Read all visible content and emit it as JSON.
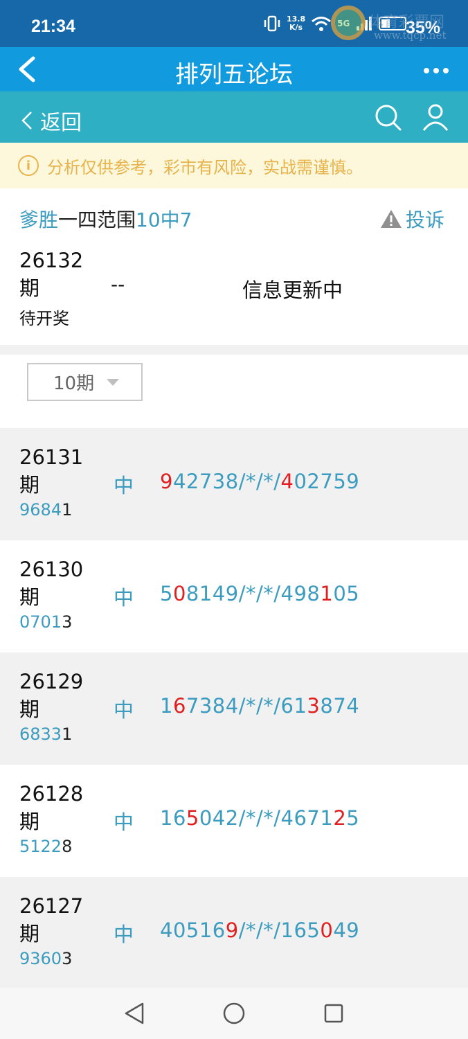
{
  "status_bar": {
    "time": "21:34",
    "net_speed_value": "13.8",
    "net_speed_unit": "K/s",
    "network": "5G",
    "battery": "35%",
    "watermark": "体育彩票网",
    "watermark_url": "www.tqcp.net"
  },
  "app_bar": {
    "title": "排列五论坛"
  },
  "sub_bar": {
    "back_label": "返回"
  },
  "notice": {
    "icon": "i",
    "text": "分析仅供参考，彩市有风险，实战需谨慎。"
  },
  "post": {
    "author": "爹胜",
    "title": "一四范围",
    "hit_rate": "10中7",
    "complain_label": "投诉",
    "current": {
      "issue": "26132",
      "issue_suffix": "期",
      "status": "待开奖",
      "prediction": "--",
      "note": "信息更新中"
    }
  },
  "filter": {
    "selected": "10期"
  },
  "records": [
    {
      "issue": "26131",
      "suffix": "期",
      "draw_hit": "9684",
      "draw_rest": "1",
      "result": "中",
      "pred": [
        {
          "t": "9",
          "r": true
        },
        {
          "t": "42738/*/*/",
          "r": false
        },
        {
          "t": "4",
          "r": true
        },
        {
          "t": "02759",
          "r": false
        }
      ]
    },
    {
      "issue": "26130",
      "suffix": "期",
      "draw_hit": "0701",
      "draw_rest": "3",
      "result": "中",
      "pred": [
        {
          "t": "5",
          "r": false
        },
        {
          "t": "0",
          "r": true
        },
        {
          "t": "8149/*/*/498",
          "r": false
        },
        {
          "t": "1",
          "r": true
        },
        {
          "t": "05",
          "r": false
        }
      ]
    },
    {
      "issue": "26129",
      "suffix": "期",
      "draw_hit": "6833",
      "draw_rest": "1",
      "result": "中",
      "pred": [
        {
          "t": "1",
          "r": false
        },
        {
          "t": "6",
          "r": true
        },
        {
          "t": "7384/*/*/61",
          "r": false
        },
        {
          "t": "3",
          "r": true
        },
        {
          "t": "874",
          "r": false
        }
      ]
    },
    {
      "issue": "26128",
      "suffix": "期",
      "draw_hit": "5122",
      "draw_rest": "8",
      "result": "中",
      "pred": [
        {
          "t": "16",
          "r": false
        },
        {
          "t": "5",
          "r": true
        },
        {
          "t": "042/*/*/4671",
          "r": false
        },
        {
          "t": "2",
          "r": true
        },
        {
          "t": "5",
          "r": false
        }
      ]
    },
    {
      "issue": "26127",
      "suffix": "期",
      "draw_hit": "9360",
      "draw_rest": "3",
      "result": "中",
      "pred": [
        {
          "t": "40516",
          "r": false
        },
        {
          "t": "9",
          "r": true
        },
        {
          "t": "/*/*/165",
          "r": false
        },
        {
          "t": "0",
          "r": true
        },
        {
          "t": "49",
          "r": false
        }
      ]
    }
  ],
  "colors": {
    "status_bar": "#1668a8",
    "app_bar": "#129ade",
    "sub_bar": "#2eafc3",
    "notice_bg": "#fdf7dc",
    "notice_text": "#e7b34a",
    "accent_blue": "#3c9cbf",
    "hit_red": "#e02020"
  }
}
